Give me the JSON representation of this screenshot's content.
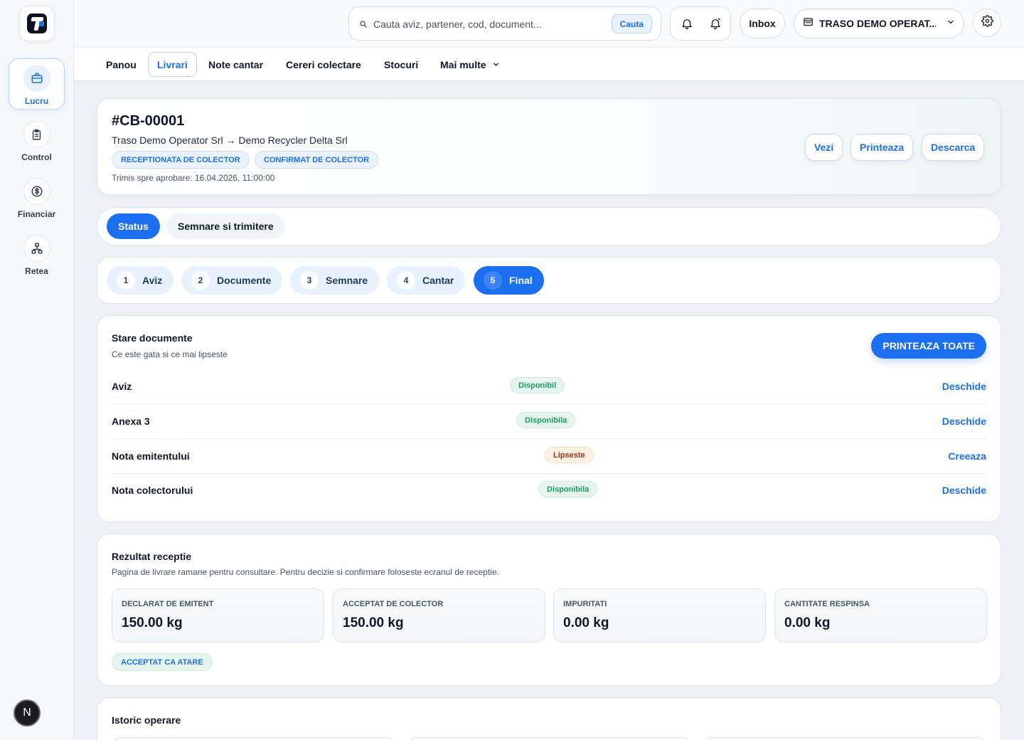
{
  "sidebar": {
    "items": [
      {
        "label": "Lucru",
        "icon": "briefcase-icon"
      },
      {
        "label": "Control",
        "icon": "clipboard-icon"
      },
      {
        "label": "Financiar",
        "icon": "dollar-circle-icon"
      },
      {
        "label": "Retea",
        "icon": "network-icon"
      }
    ],
    "avatar_letter": "N"
  },
  "header": {
    "search_placeholder": "Cauta aviz, partener, cod, document...",
    "search_button": "Cauta",
    "inbox_label": "Inbox",
    "company_name": "TRASO DEMO OPERAT..."
  },
  "tabs": [
    "Panou",
    "Livrari",
    "Note cantar",
    "Cereri colectare",
    "Stocuri",
    "Mai multe"
  ],
  "delivery": {
    "code": "#CB-00001",
    "route": "Traso Demo Operator Srl → Demo Recycler Delta Srl",
    "chips": [
      "RECEPTIONATA DE COLECTOR",
      "CONFIRMAT DE COLECTOR"
    ],
    "sent": "Trimis spre aprobare: 16.04.2026, 11:00:00",
    "actions": [
      "Vezi",
      "Printeaza",
      "Descarca"
    ]
  },
  "segments": [
    "Status",
    "Semnare si trimitere"
  ],
  "steps": [
    {
      "num": "1",
      "label": "Aviz"
    },
    {
      "num": "2",
      "label": "Documente"
    },
    {
      "num": "3",
      "label": "Semnare"
    },
    {
      "num": "4",
      "label": "Cantar"
    },
    {
      "num": "5",
      "label": "Final"
    }
  ],
  "documents": {
    "title": "Stare documente",
    "subtitle": "Ce este gata si ce mai lipseste",
    "print_all": "PRINTEAZA TOATE",
    "rows": [
      {
        "name": "Aviz",
        "status": "Disponibil",
        "action": "Deschide"
      },
      {
        "name": "Anexa 3",
        "status": "Disponibila",
        "action": "Deschide"
      },
      {
        "name": "Nota emitentului",
        "status": "Lipseste",
        "action": "Creeaza"
      },
      {
        "name": "Nota colectorului",
        "status": "Disponibila",
        "action": "Deschide"
      }
    ]
  },
  "result": {
    "title": "Rezultat receptie",
    "subtitle": "Pagina de livrare ramane pentru consultare. Pentru decizie si confirmare foloseste ecranul de receptie.",
    "metrics": [
      {
        "label": "DECLARAT DE EMITENT",
        "value": "150.00 kg"
      },
      {
        "label": "ACCEPTAT DE COLECTOR",
        "value": "150.00 kg"
      },
      {
        "label": "IMPURITATI",
        "value": "0.00 kg"
      },
      {
        "label": "CANTITATE RESPINSA",
        "value": "0.00 kg"
      }
    ],
    "accepted_chip": "ACCEPTAT CA ATARE"
  },
  "history": {
    "title": "Istoric operare"
  },
  "colors": {
    "accent": "#1d6ff2",
    "ok": "#16a05e",
    "missing": "#9a3412"
  }
}
